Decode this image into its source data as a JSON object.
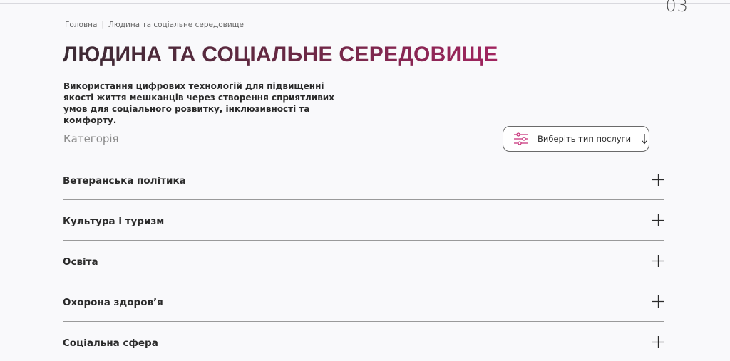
{
  "corner_number": "03",
  "breadcrumb": {
    "home": "Головна",
    "separator": "|",
    "current": "Людина та соціальне середовище"
  },
  "page": {
    "title": "ЛЮДИНА ТА СОЦІАЛЬНЕ СЕРЕДОВИЩЕ",
    "description": "Використання цифрових технологій для підвищенні якості життя мешканців через створення сприятливих умов для соціального розвитку, інклюзивності та комфорту."
  },
  "filter": {
    "category_label": "Категорія",
    "button_label": "Виберіть тип послуги",
    "icon": "sliders-icon",
    "accent_color": "#c8327a"
  },
  "categories": [
    {
      "label": "Ветеранська політика",
      "icon": "plus-icon"
    },
    {
      "label": "Культура і туризм",
      "icon": "plus-icon"
    },
    {
      "label": "Освіта",
      "icon": "plus-icon"
    },
    {
      "label": "Охорона здоров’я",
      "icon": "plus-icon"
    },
    {
      "label": "Соціальна сфера",
      "icon": "plus-icon"
    }
  ]
}
